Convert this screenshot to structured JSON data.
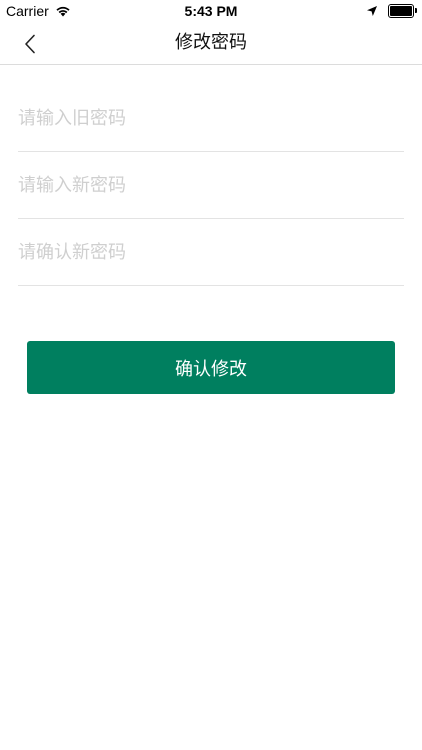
{
  "status_bar": {
    "carrier": "Carrier",
    "time": "5:43 PM",
    "icons": [
      "wifi-icon",
      "location-arrow-icon",
      "battery-icon"
    ]
  },
  "nav": {
    "back_icon": "chevron-left-icon",
    "title": "修改密码"
  },
  "form": {
    "old_password": {
      "value": "",
      "placeholder": "请输入旧密码"
    },
    "new_password": {
      "value": "",
      "placeholder": "请输入新密码"
    },
    "confirm_password": {
      "value": "",
      "placeholder": "请确认新密码"
    }
  },
  "actions": {
    "confirm_label": "确认修改"
  },
  "colors": {
    "accent": "#007f5f",
    "placeholder": "#cfcfcf",
    "divider": "#e3e3e3"
  }
}
